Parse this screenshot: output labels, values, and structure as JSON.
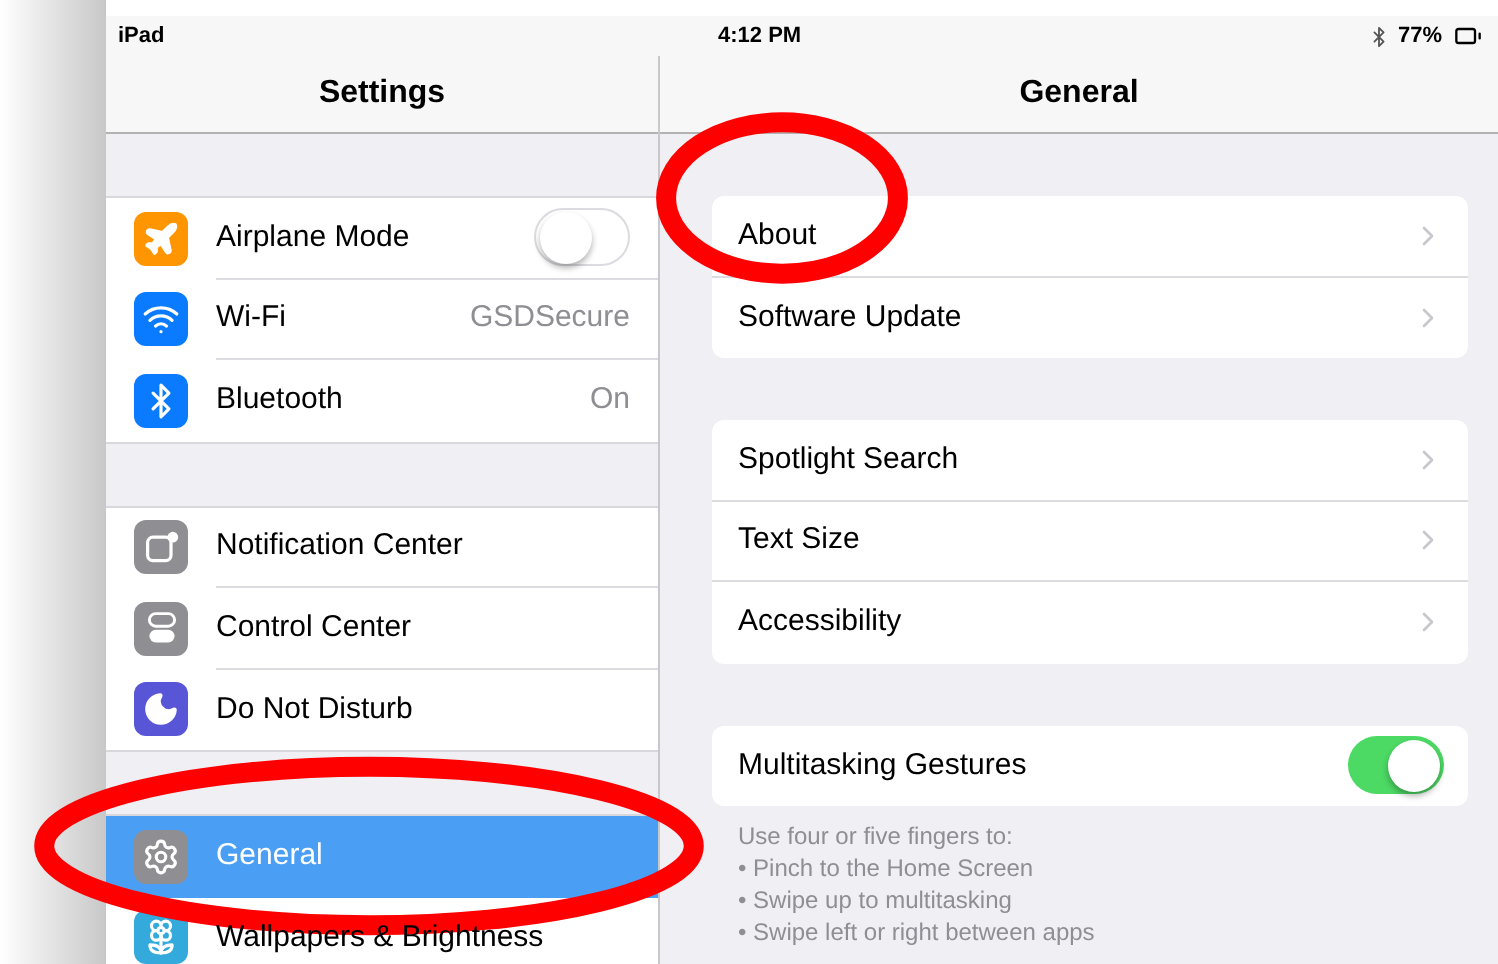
{
  "status_bar": {
    "device": "iPad",
    "time": "4:12 PM",
    "battery": "77%"
  },
  "sidebar": {
    "title": "Settings",
    "groups": [
      [
        {
          "label": "Airplane Mode",
          "kind": "toggle",
          "on": false,
          "color": "#ff9500",
          "selected": false,
          "circled": false
        },
        {
          "label": "Wi-Fi",
          "kind": "value",
          "value": "GSDSecure",
          "color": "#0a7aff",
          "selected": false,
          "circled": false
        },
        {
          "label": "Bluetooth",
          "kind": "value",
          "value": "On",
          "color": "#0a7aff",
          "selected": false,
          "circled": false
        }
      ],
      [
        {
          "label": "Notification Center",
          "kind": "plain",
          "color": "#8e8e93",
          "selected": false,
          "circled": false
        },
        {
          "label": "Control Center",
          "kind": "plain",
          "color": "#8e8e93",
          "selected": false,
          "circled": false
        },
        {
          "label": "Do Not Disturb",
          "kind": "plain",
          "color": "#5856d6",
          "selected": false,
          "circled": false
        }
      ],
      [
        {
          "label": "General",
          "kind": "plain",
          "color": "#8e8e93",
          "selected": true,
          "circled": true
        },
        {
          "label": "Wallpapers & Brightness",
          "kind": "plain",
          "color": "#34aadc",
          "selected": false,
          "circled": false
        }
      ]
    ]
  },
  "detail": {
    "title": "General",
    "groups": [
      {
        "rows": [
          {
            "label": "About",
            "kind": "link",
            "circled": true
          },
          {
            "label": "Software Update",
            "kind": "link",
            "circled": false
          }
        ]
      },
      {
        "rows": [
          {
            "label": "Spotlight Search",
            "kind": "link",
            "circled": false
          },
          {
            "label": "Text Size",
            "kind": "link",
            "circled": false
          },
          {
            "label": "Accessibility",
            "kind": "link",
            "circled": false
          }
        ]
      },
      {
        "rows": [
          {
            "label": "Multitasking Gestures",
            "kind": "toggle",
            "on": true,
            "circled": false
          }
        ],
        "footer": [
          "Use four or five fingers to:",
          "• Pinch to the Home Screen",
          "• Swipe up to multitasking",
          "• Swipe left or right between apps"
        ]
      }
    ]
  }
}
